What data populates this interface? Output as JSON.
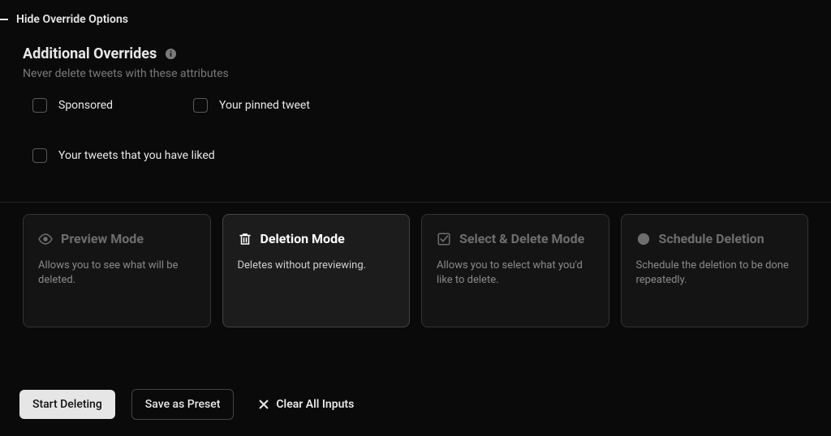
{
  "collapse": {
    "label": "Hide Override Options"
  },
  "section": {
    "title": "Additional Overrides",
    "desc": "Never delete tweets with these attributes"
  },
  "checkboxes": {
    "sponsored": "Sponsored",
    "pinned": "Your pinned tweet",
    "liked": "Your tweets that you have liked"
  },
  "modes": {
    "preview": {
      "title": "Preview Mode",
      "desc": "Allows you to see what will be deleted."
    },
    "deletion": {
      "title": "Deletion Mode",
      "desc": "Deletes without previewing."
    },
    "select": {
      "title": "Select & Delete Mode",
      "desc": "Allows you to select what you'd like to delete."
    },
    "schedule": {
      "title": "Schedule Deletion",
      "desc": "Schedule the deletion to be done repeatedly."
    }
  },
  "actions": {
    "start": "Start Deleting",
    "save": "Save as Preset",
    "clear": "Clear All Inputs"
  }
}
